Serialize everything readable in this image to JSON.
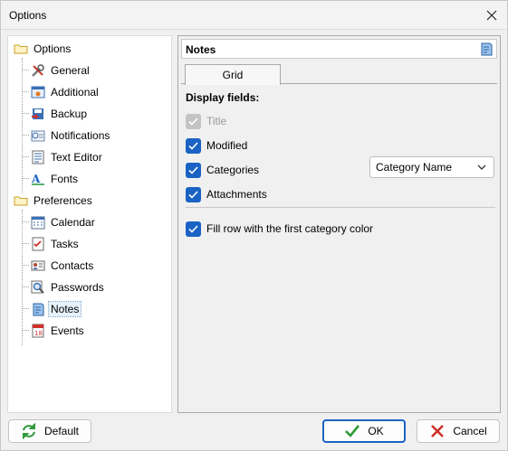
{
  "window": {
    "title": "Options"
  },
  "tree": {
    "groups": [
      {
        "label": "Options",
        "items": [
          {
            "label": "General"
          },
          {
            "label": "Additional"
          },
          {
            "label": "Backup"
          },
          {
            "label": "Notifications"
          },
          {
            "label": "Text Editor"
          },
          {
            "label": "Fonts"
          }
        ]
      },
      {
        "label": "Preferences",
        "items": [
          {
            "label": "Calendar"
          },
          {
            "label": "Tasks"
          },
          {
            "label": "Contacts"
          },
          {
            "label": "Passwords"
          },
          {
            "label": "Notes",
            "selected": true
          },
          {
            "label": "Events"
          }
        ]
      }
    ]
  },
  "panel": {
    "title": "Notes",
    "tab": "Grid",
    "section_label": "Display fields:",
    "fields": [
      {
        "label": "Title",
        "checked": true,
        "disabled": true
      },
      {
        "label": "Modified",
        "checked": true
      },
      {
        "label": "Categories",
        "checked": true
      },
      {
        "label": "Attachments",
        "checked": true
      }
    ],
    "category_combo": {
      "value": "Category Name"
    },
    "fill_row": {
      "label": "Fill row with the first category color",
      "checked": true
    }
  },
  "buttons": {
    "default": "Default",
    "ok": "OK",
    "cancel": "Cancel"
  },
  "colors": {
    "accent": "#1a63c4",
    "selection": "#e5f1fb"
  }
}
